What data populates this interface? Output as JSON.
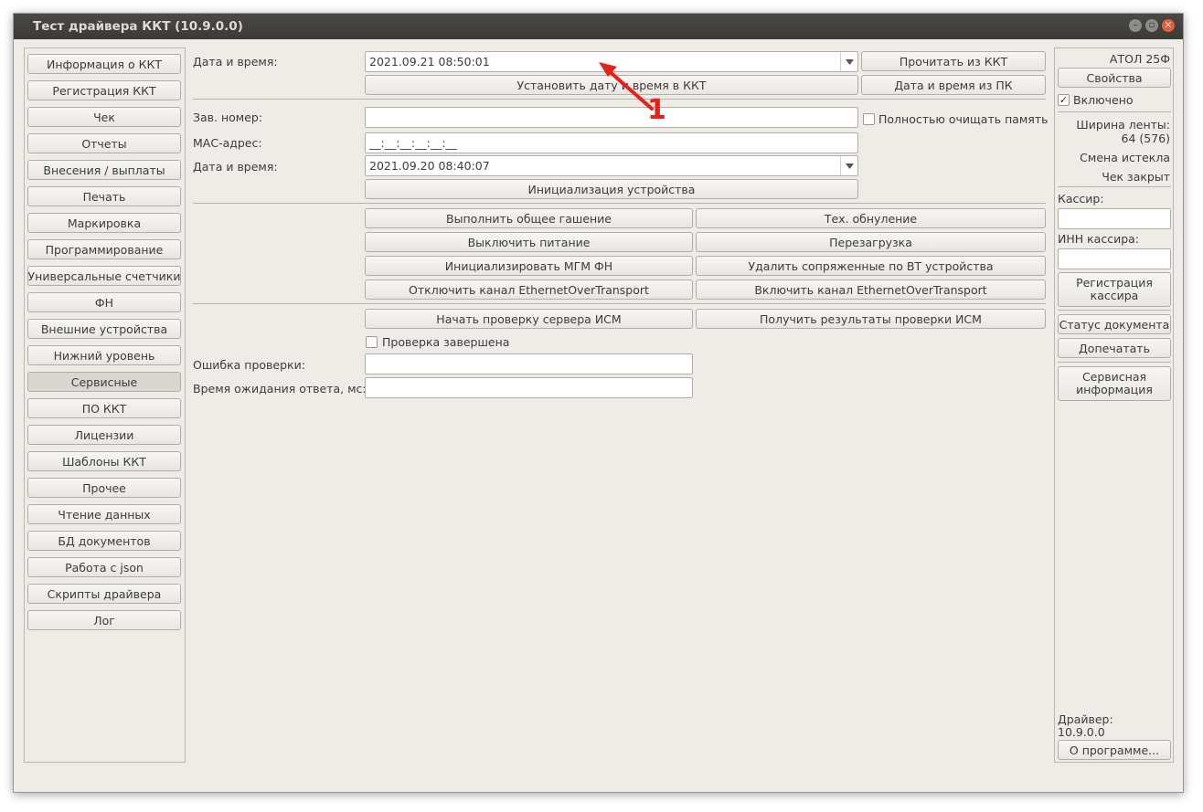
{
  "window": {
    "title": "Тест драйвера ККТ (10.9.0.0)"
  },
  "nav": {
    "items": [
      "Информация о ККТ",
      "Регистрация ККТ",
      "Чек",
      "Отчеты",
      "Внесения / выплаты",
      "Печать",
      "Маркировка",
      "Программирование",
      "Универсальные счетчики",
      "ФН",
      "Внешние устройства",
      "Нижний уровень",
      "Сервисные",
      "ПО ККТ",
      "Лицензии",
      "Шаблоны ККТ",
      "Прочее",
      "Чтение данных",
      "БД документов",
      "Работа с json",
      "Скрипты драйвера",
      "Лог"
    ],
    "active": "Сервисные"
  },
  "main": {
    "datetime_label": "Дата и время:",
    "datetime_value": "2021.09.21 08:50:01",
    "read_from_kkt": "Прочитать из ККТ",
    "set_datetime": "Установить дату и время в ККТ",
    "datetime_from_pc": "Дата и время из ПК",
    "serial_label": "Зав. номер:",
    "serial_value": "",
    "clear_memory": "Полностью очищать память",
    "mac_label": "МАС-адрес:",
    "mac_value": "__:__:__:__:__:__",
    "init_datetime_label": "Дата и время:",
    "init_datetime_value": "2021.09.20 08:40:07",
    "init_device": "Инициализация устройства",
    "general_clear": "Выполнить общее гашение",
    "tech_reset": "Тех. обнуление",
    "power_off": "Выключить питание",
    "reboot": "Перезагрузка",
    "init_mgm": "Инициализировать МГМ ФН",
    "remove_bt": "Удалить сопряженные по BT устройства",
    "disable_eot": "Отключить канал EthernetOverTransport",
    "enable_eot": "Включить канал EthernetOverTransport",
    "start_ism": "Начать проверку сервера ИСМ",
    "get_ism": "Получить результаты проверки ИСМ",
    "check_done": "Проверка завершена",
    "check_error_label": "Ошибка проверки:",
    "check_error_value": "",
    "timeout_label": "Время ожидания ответа, мс:",
    "timeout_value": ""
  },
  "right": {
    "model": "АТОЛ 25Ф",
    "properties": "Свойства",
    "enabled": "Включено",
    "tape_width_label": "Ширина ленты:",
    "tape_width_value": "64 (576)",
    "shift_status": "Смена истекла",
    "receipt_status": "Чек закрыт",
    "cashier_label": "Кассир:",
    "cashier_value": "",
    "inn_label": "ИНН кассира:",
    "inn_value": "",
    "register_cashier": "Регистрация кассира",
    "doc_status": "Статус документа",
    "reprint": "Допечатать",
    "service_info": "Сервисная информация",
    "driver_label": "Драйвер:",
    "driver_version": "10.9.0.0",
    "about": "О программе..."
  },
  "annotation": {
    "number": "1",
    "color": "#e8201a"
  },
  "colors": {
    "window_bg": "#efebe7",
    "titlebar": "#3b3a37",
    "close_button": "#e0623a"
  }
}
